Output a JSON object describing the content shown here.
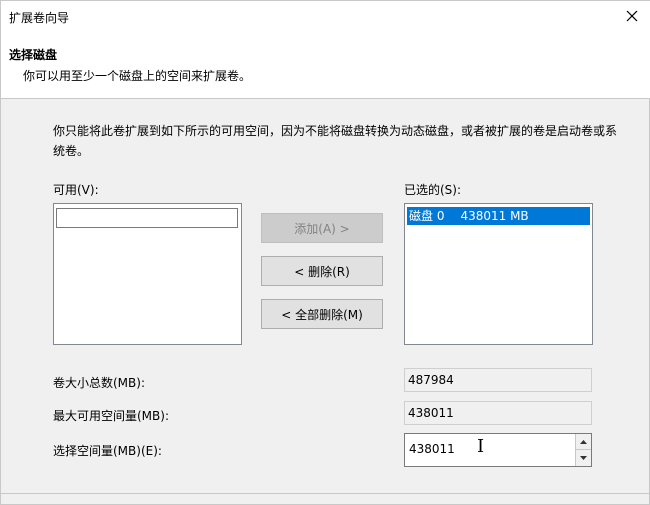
{
  "window": {
    "title": "扩展卷向导"
  },
  "header": {
    "title": "选择磁盘",
    "subtitle": "你可以用至少一个磁盘上的空间来扩展卷。"
  },
  "description": "你只能将此卷扩展到如下所示的可用空间，因为不能将磁盘转换为动态磁盘，或者被扩展的卷是启动卷或系统卷。",
  "available": {
    "label": "可用(V):",
    "items": [
      ""
    ]
  },
  "selected": {
    "label": "已选的(S):",
    "items": [
      {
        "disk": "磁盘 0",
        "size": "438011 MB"
      }
    ]
  },
  "buttons": {
    "add": "添加(A) >",
    "remove": "< 删除(R)",
    "remove_all": "< 全部删除(M)"
  },
  "fields": {
    "total_label": "卷大小总数(MB):",
    "total_value": "487984",
    "max_label": "最大可用空间量(MB):",
    "max_value": "438011",
    "select_label": "选择空间量(MB)(E):",
    "select_value": "438011"
  },
  "icons": {
    "close": "close-icon",
    "spin_up": "spin-up-icon",
    "spin_down": "spin-down-icon"
  }
}
